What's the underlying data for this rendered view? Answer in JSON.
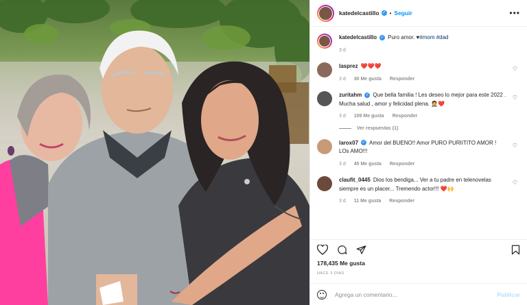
{
  "colors": {
    "link_blue": "#0095f6",
    "verified_blue": "#3897f0",
    "heart_red": "#ed4956",
    "muted_gray": "#8e8e8e"
  },
  "header": {
    "username": "katedelcastillo",
    "separator": "•",
    "follow_label": "Seguir",
    "more_icon": "ellipsis-icon"
  },
  "caption": {
    "username": "katedelcastillo",
    "text": "Puro amor. ♥",
    "tags": "#mom #dad",
    "time": "3 d"
  },
  "comments": [
    {
      "username": "lasprez",
      "text": "❤️❤️❤️",
      "time": "3 d",
      "likes": "30 Me gusta",
      "reply": "Responder",
      "verified": false
    },
    {
      "username": "zuritahm",
      "text": "Que bella familia ! Les deseo lo mejor para este 2022 . Mucha salud , amor y felicidad plena. 🤵❤️",
      "time": "3 d",
      "likes": "109 Me gusta",
      "reply": "Responder",
      "verified": true,
      "view_replies": "Ver respuestas (1)"
    },
    {
      "username": "larox07",
      "text": "Amor del BUENO!! Amor PURO PURIITITO AMOR ! LOs AMO!!!",
      "time": "3 d",
      "likes": "45 Me gusta",
      "reply": "Responder",
      "verified": true
    },
    {
      "username": "claufit_0445",
      "text": "Dios los bendiga... Ver a tu padre en telenovelas siempre es un placer... Tremendo actor!!! ❤️🙌",
      "time": "3 d",
      "likes": "11 Me gusta",
      "reply": "Responder",
      "verified": false
    }
  ],
  "actions": {
    "like_icon": "heart-icon",
    "comment_icon": "comment-icon",
    "share_icon": "share-icon",
    "save_icon": "bookmark-icon"
  },
  "likes_text": "178,435 Me gusta",
  "date_text": "HACE 3 DÍAS",
  "add_comment": {
    "placeholder": "Agrega un comentario...",
    "publish_label": "Publicar",
    "emoji_icon": "emoji-icon"
  }
}
